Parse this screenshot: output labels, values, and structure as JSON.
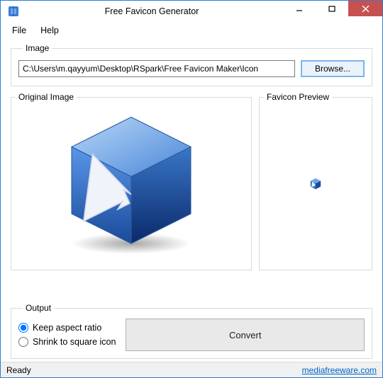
{
  "title": "Free Favicon Generator",
  "menu": {
    "file": "File",
    "help": "Help"
  },
  "image_group": {
    "label": "Image",
    "path": "C:\\Users\\m.qayyum\\Desktop\\RSpark\\Free Favicon Maker\\Icon",
    "browse": "Browse..."
  },
  "original_group": {
    "label": "Original Image"
  },
  "favicon_group": {
    "label": "Favicon Preview"
  },
  "output_group": {
    "label": "Output",
    "keep": "Keep aspect ratio",
    "shrink": "Shrink to square icon",
    "convert": "Convert"
  },
  "status": {
    "ready": "Ready",
    "link": "mediafreeware.com"
  }
}
